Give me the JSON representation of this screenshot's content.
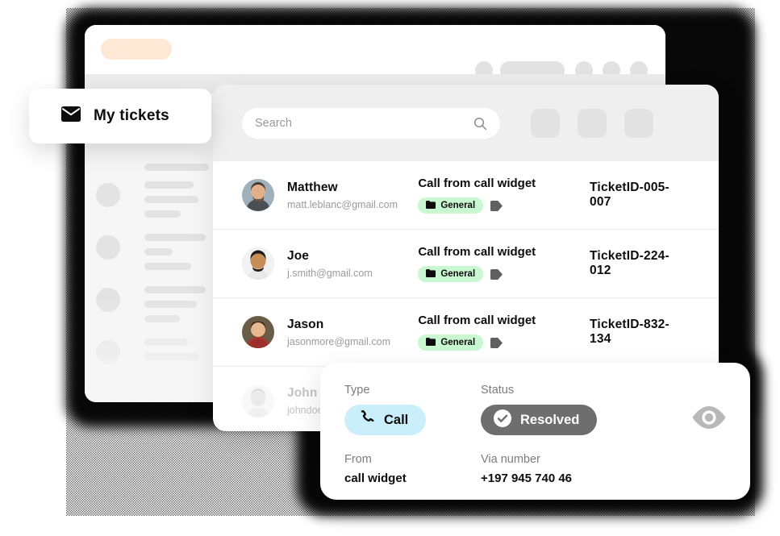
{
  "browser": {
    "tab_placeholder": "",
    "controls": [
      "circle",
      "pill",
      "circle",
      "circle",
      "circle"
    ]
  },
  "my_tickets": {
    "label": "My tickets",
    "icon": "envelope-icon"
  },
  "tickets_panel": {
    "search": {
      "placeholder": "Search",
      "icon": "search-icon"
    },
    "filter_buttons": [
      "filter-button-1",
      "filter-button-2",
      "filter-button-3"
    ],
    "rows": [
      {
        "name": "Matthew",
        "email": "matt.leblanc@gmail.com",
        "subject": "Call from call widget",
        "tag": "General",
        "ticket_id": "TicketID-005-007",
        "faded": false,
        "avatar_hue": 24
      },
      {
        "name": "Joe",
        "email": "j.smith@gmail.com",
        "subject": "Call from call widget",
        "tag": "General",
        "ticket_id": "TicketID-224-012",
        "faded": false,
        "avatar_hue": 30
      },
      {
        "name": "Jason",
        "email": "jasonmore@gmail.com",
        "subject": "Call from call widget",
        "tag": "General",
        "ticket_id": "TicketID-832-134",
        "faded": false,
        "avatar_hue": 12
      },
      {
        "name": "John Doe",
        "email": "johndoe@gmail.com",
        "subject": "",
        "tag": "",
        "ticket_id": "",
        "faded": true,
        "avatar_hue": 20
      }
    ]
  },
  "detail_card": {
    "type_label": "Type",
    "type_value": "Call",
    "type_icon": "phone-icon",
    "status_label": "Status",
    "status_value": "Resolved",
    "status_icon": "check-circle-icon",
    "from_label": "From",
    "from_value": "call widget",
    "via_label": "Via number",
    "via_value": "+197 945 740 46",
    "eye_icon": "eye-icon"
  },
  "colors": {
    "tag_green": "#c9f7d0",
    "call_blue": "#cbeefb",
    "status_gray": "#6e6e6e",
    "tab_peach": "#fce8d5",
    "skeleton_gray": "#e3e3e3"
  }
}
